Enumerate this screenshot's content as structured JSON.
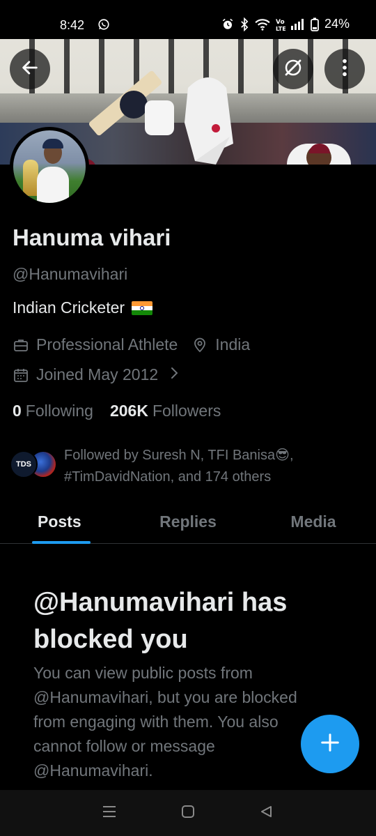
{
  "status_bar": {
    "time": "8:42",
    "battery": "24%",
    "icons": [
      "whatsapp-icon",
      "alarm-icon",
      "bluetooth-icon",
      "wifi-icon",
      "volte-icon",
      "signal-icon",
      "battery-icon"
    ],
    "volte_label": "Vo\nLTE"
  },
  "header": {
    "icons": [
      "back-arrow-icon",
      "explore-off-icon",
      "more-vertical-icon"
    ]
  },
  "profile": {
    "name": "Hanuma vihari",
    "handle": "@Hanumavihari",
    "bio": "Indian Cricketer",
    "category": "Professional Athlete",
    "location": "India",
    "joined": "Joined May 2012",
    "following_count": "0",
    "following_label": "Following",
    "followers_count": "206K",
    "followers_label": "Followers",
    "followed_by": "Followed by Suresh N, TFI Banisa😎, #TimDavidNation, and 174 others",
    "follower_avatar_1_text": "TDS"
  },
  "tabs": [
    {
      "label": "Posts",
      "active": true
    },
    {
      "label": "Replies",
      "active": false
    },
    {
      "label": "Media",
      "active": false
    }
  ],
  "blocked": {
    "title": "@Hanumavihari has blocked you",
    "body": "You can view public posts from @Hanumavihari, but you are blocked from engaging with them. You also cannot follow or message @Hanumavihari."
  },
  "colors": {
    "accent": "#1d9bf0",
    "background": "#000000",
    "secondary_text": "#71767b",
    "primary_text": "#e7e9ea"
  }
}
